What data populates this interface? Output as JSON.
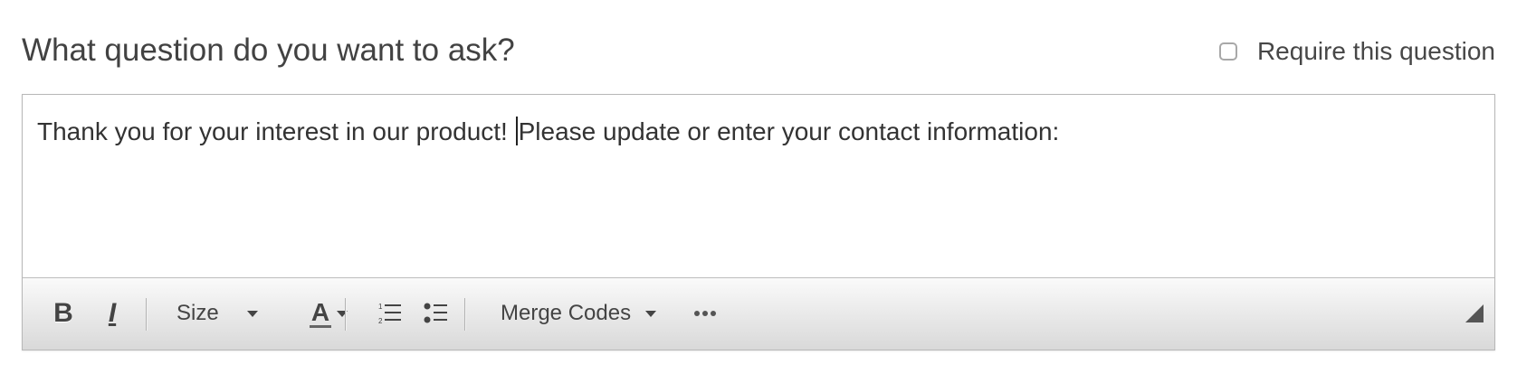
{
  "question": {
    "heading": "What question do you want to ask?",
    "require_label": "Require this question",
    "require_checked": false
  },
  "editor": {
    "text_before_cursor": "Thank you for your interest in our product! ",
    "text_after_cursor": "Please update or enter your contact information:",
    "toolbar": {
      "bold_label": "B",
      "italic_label": "I",
      "size_label": "Size",
      "color_label": "A",
      "merge_codes_label": "Merge Codes",
      "ordered_list_icon": "ordered-list-icon",
      "unordered_list_icon": "unordered-list-icon",
      "more_icon": "more-icon"
    }
  }
}
